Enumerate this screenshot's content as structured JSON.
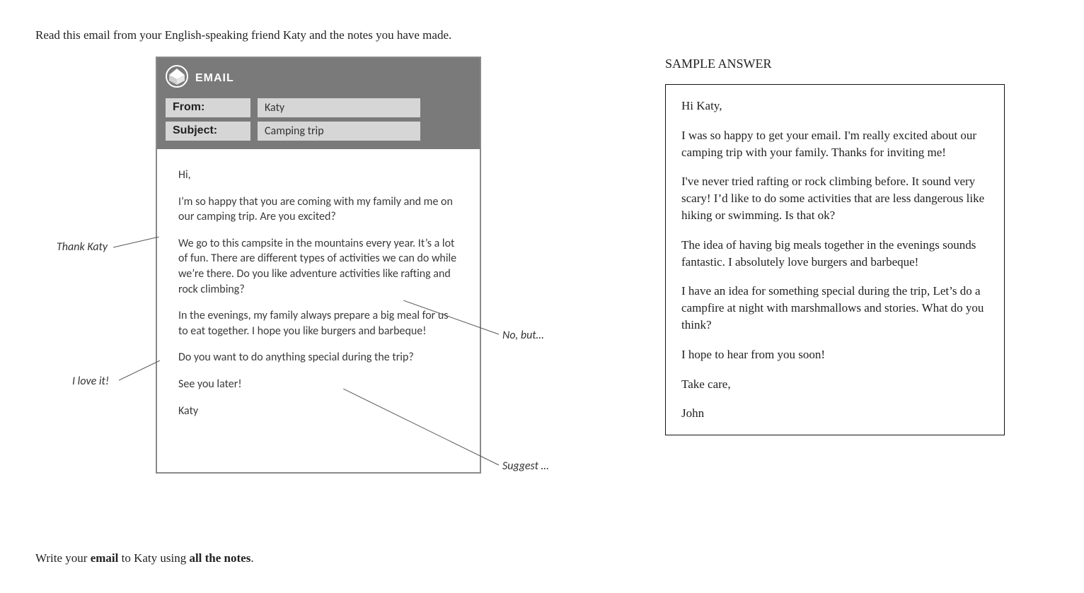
{
  "instruction_top": "Read this email from your English-speaking friend Katy and the notes you have made.",
  "instruction_bottom_pre": "Write your ",
  "instruction_bottom_b1": "email",
  "instruction_bottom_mid": " to Katy using ",
  "instruction_bottom_b2": "all the notes",
  "instruction_bottom_post": ".",
  "email": {
    "app_label": "EMAIL",
    "from_label": "From:",
    "from_value": "Katy",
    "subject_label": "Subject:",
    "subject_value": "Camping trip",
    "body": {
      "p1": "Hi,",
      "p2": "I’m so happy that you are coming with my family and me on our camping trip. Are you excited?",
      "p3": "We go to this campsite in the mountains every year. It’s a lot of fun. There are different types of activities we can do while we’re there. Do you like adventure activities like rafting and rock climbing?",
      "p4": "In the evenings, my family always prepare a big meal for us to eat together. I hope you like burgers and barbeque!",
      "p5": "Do you want to do anything special during the trip?",
      "p6": "See you later!",
      "p7": "Katy"
    }
  },
  "annotations": {
    "a1": "Thank Katy",
    "a2": "I love it!",
    "a3": "No, but…",
    "a4": "Suggest …"
  },
  "sample": {
    "title": "SAMPLE ANSWER",
    "p1": "Hi Katy,",
    "p2": "I was so happy to get your email. I'm really excited about our camping trip with your family. Thanks for inviting me!",
    "p3": "I've never tried rafting or rock climbing before. It sound very scary! I’d like to do some activities that are less dangerous like hiking or swimming. Is that ok?",
    "p4": "The idea of having big meals together in the evenings sounds fantastic. I absolutely love burgers and barbeque!",
    "p5": "I have an idea for something special during the trip, Let’s do a campfire at night with marshmallows and stories. What do you think?",
    "p6": "I hope to hear from you soon!",
    "p7": "Take care,",
    "p8": "John"
  }
}
